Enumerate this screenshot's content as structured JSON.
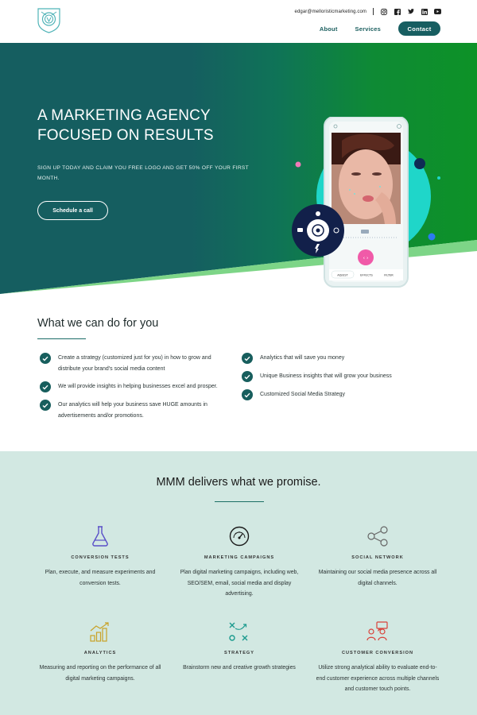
{
  "header": {
    "email": "edgar@melloristicmarketing.com",
    "social_icons": [
      "instagram-icon",
      "facebook-icon",
      "twitter-icon",
      "linkedin-icon",
      "youtube-icon"
    ],
    "nav": [
      {
        "label": "About"
      },
      {
        "label": "Services"
      }
    ],
    "contact_label": "Contact"
  },
  "hero": {
    "title": "A MARKETING AGENCY FOCUSED ON RESULTS",
    "subtitle": "SIGN UP TODAY AND CLAIM YOU FREE LOGO AND GET 50% OFF YOUR FIRST MONTH.",
    "cta": "Schedule a call",
    "phone_tabs": [
      "ADJUST",
      "EFFECTS",
      "FILTER"
    ]
  },
  "what": {
    "title": "What we can do for you",
    "left_items": [
      "Create a strategy (customized just for you) in how to grow and distribute your brand's social media content",
      "We will provide insights in helping businesses excel and prosper.",
      "Our analytics will help your business save HUGE amounts in advertisements and/or promotions."
    ],
    "right_items": [
      "Analytics that will save you money",
      "Unique Business insights that will grow your business",
      "Customized Social Media Strategy"
    ]
  },
  "deliver": {
    "title": "MMM delivers what we promise.",
    "features": [
      {
        "title": "CONVERSION TESTS",
        "desc": "Plan, execute, and measure experiments and conversion tests.",
        "icon": "flask-icon"
      },
      {
        "title": "MARKETING CAMPAIGNS",
        "desc": "Plan digital marketing campaigns, including web, SEO/SEM, email, social media and display advertising.",
        "icon": "gauge-icon"
      },
      {
        "title": "SOCIAL NETWORK",
        "desc": "Maintaining our social media presence across all digital channels.",
        "icon": "share-icon"
      },
      {
        "title": "ANALYTICS",
        "desc": "Measuring and reporting on the performance of all digital marketing campaigns.",
        "icon": "analytics-icon"
      },
      {
        "title": "STRATEGY",
        "desc": "Brainstorm new and creative growth strategies",
        "icon": "strategy-icon"
      },
      {
        "title": "CUSTOMER CONVERSION",
        "desc": "Utilize strong analytical ability to evaluate end-to-end customer experience across multiple channels and customer touch points.",
        "icon": "customer-icon"
      }
    ]
  },
  "colors": {
    "primary": "#175e61",
    "green": "#0d9227",
    "mint": "#d2e8e2",
    "cyan": "#1fd6c9",
    "pink": "#f05aa8"
  }
}
